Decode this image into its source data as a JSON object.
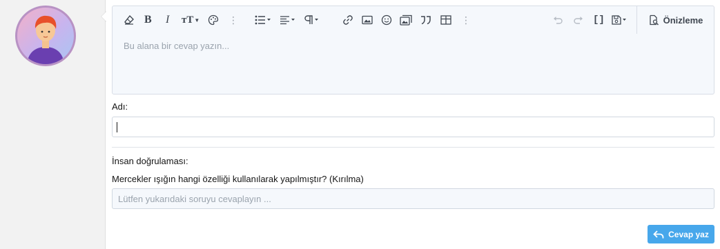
{
  "editor": {
    "placeholder": "Bu alana bir cevap yazın...",
    "preview_label": "Önizleme",
    "toolbar_icons": [
      "eraser-icon",
      "bold-icon",
      "italic-icon",
      "text-size-icon",
      "palette-icon",
      "more-icon",
      "list-icon",
      "align-icon",
      "paragraph-icon",
      "more-icon",
      "link-icon",
      "image-icon",
      "smiley-icon",
      "media-icon",
      "quote-icon",
      "table-icon",
      "more-icon",
      "undo-icon",
      "redo-icon",
      "bbcode-icon",
      "drafts-icon",
      "preview-icon"
    ]
  },
  "form": {
    "name_label": "Adı:",
    "name_value": "",
    "captcha_label": "İnsan doğrulaması:",
    "captcha_question": "Mercekler ışığın hangi özelliği kullanılarak yapılmıştır? (Kırılma)",
    "captcha_placeholder": "Lütfen yukarıdaki soruyu cevaplayın ..."
  },
  "actions": {
    "submit_label": "Cevap yaz"
  },
  "colors": {
    "accent": "#47a7eb",
    "avatar_border": "#b892c4",
    "editor_bg": "#f5f8fc"
  }
}
